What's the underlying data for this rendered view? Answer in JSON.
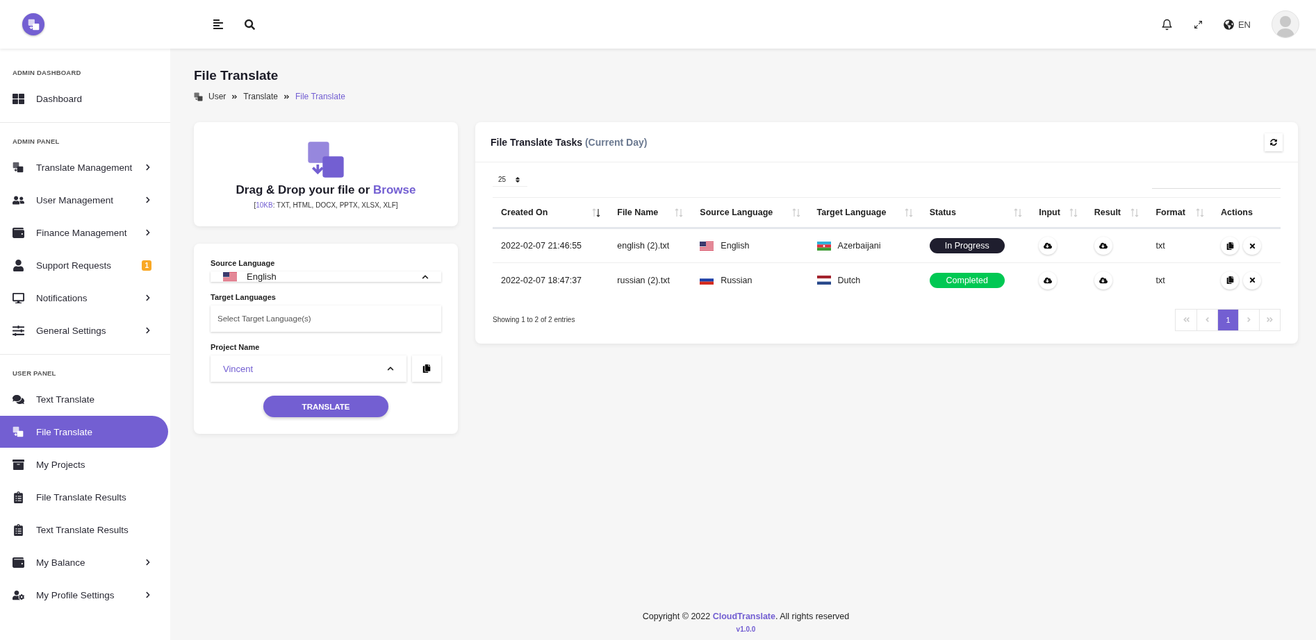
{
  "topbar": {
    "language": "EN"
  },
  "sidebar": {
    "sections": [
      {
        "title": "ADMIN DASHBOARD",
        "items": [
          {
            "label": "Dashboard",
            "selected": false,
            "submenu": false
          }
        ]
      },
      {
        "title": "ADMIN PANEL",
        "items": [
          {
            "label": "Translate Management",
            "selected": false,
            "submenu": true
          },
          {
            "label": "User Management",
            "selected": false,
            "submenu": true
          },
          {
            "label": "Finance Management",
            "selected": false,
            "submenu": true
          },
          {
            "label": "Support Requests",
            "selected": false,
            "submenu": false,
            "badge": "1"
          },
          {
            "label": "Notifications",
            "selected": false,
            "submenu": true
          },
          {
            "label": "General Settings",
            "selected": false,
            "submenu": true
          }
        ]
      },
      {
        "title": "USER PANEL",
        "items": [
          {
            "label": "Text Translate",
            "selected": false,
            "submenu": false
          },
          {
            "label": "File Translate",
            "selected": true,
            "submenu": false
          },
          {
            "label": "My Projects",
            "selected": false,
            "submenu": false
          },
          {
            "label": "File Translate Results",
            "selected": false,
            "submenu": false
          },
          {
            "label": "Text Translate Results",
            "selected": false,
            "submenu": false
          },
          {
            "label": "My Balance",
            "selected": false,
            "submenu": true
          },
          {
            "label": "My Profile Settings",
            "selected": false,
            "submenu": true
          }
        ]
      }
    ]
  },
  "page": {
    "title": "File Translate",
    "breadcrumb": [
      {
        "label": "User",
        "current": false
      },
      {
        "label": "Translate",
        "current": false
      },
      {
        "label": "File Translate",
        "current": true
      }
    ]
  },
  "upload": {
    "prompt": "Drag & Drop your file or",
    "link": "Browse",
    "limits": "[**10KB**: TXT, HTML, DOCX, PPTX, XLSX, XLF]"
  },
  "form": {
    "source_language": {
      "label": "Source Language",
      "value": "English"
    },
    "target_languages": {
      "label": "Target Languages",
      "placeholder": "Select Target Language(s)"
    },
    "project_name": {
      "label": "Project Name",
      "value": "Vincent"
    },
    "button": "TRANSLATE"
  },
  "tasks": {
    "title": "File Translate Tasks",
    "subtitle": "(Current Day)",
    "page_size": "25",
    "columns": [
      {
        "label": "Created On",
        "sortable": true,
        "sorted": true
      },
      {
        "label": "File Name",
        "sortable": true,
        "sorted": false
      },
      {
        "label": "Source Language",
        "sortable": true,
        "sorted": false
      },
      {
        "label": "Target Language",
        "sortable": true,
        "sorted": false
      },
      {
        "label": "Status",
        "sortable": true,
        "sorted": false
      },
      {
        "label": "Input",
        "sortable": true,
        "sorted": false
      },
      {
        "label": "Result",
        "sortable": true,
        "sorted": false
      },
      {
        "label": "Format",
        "sortable": true,
        "sorted": false
      },
      {
        "label": "Actions",
        "sortable": false
      }
    ],
    "rows": [
      {
        "created_on": "2022-02-07 21:46:55",
        "file_name": "english (2).txt",
        "source": {
          "name": "English"
        },
        "target": {
          "name": "Azerbaijani"
        },
        "status": {
          "label": "In Progress",
          "kind": "in_progress"
        },
        "format": "txt"
      },
      {
        "created_on": "2022-02-07 18:47:37",
        "file_name": "russian (2).txt",
        "source": {
          "name": "Russian"
        },
        "target": {
          "name": "Dutch"
        },
        "status": {
          "label": "Completed",
          "kind": "completed"
        },
        "format": "txt"
      }
    ],
    "info": "Showing 1 to 2 of 2 entries",
    "pages": [
      {
        "label": "1",
        "selected": true
      }
    ]
  },
  "footer": {
    "copyright": "Copyright © 2022 **CloudTranslate**. All rights reserved",
    "version": "v1.0.0"
  }
}
